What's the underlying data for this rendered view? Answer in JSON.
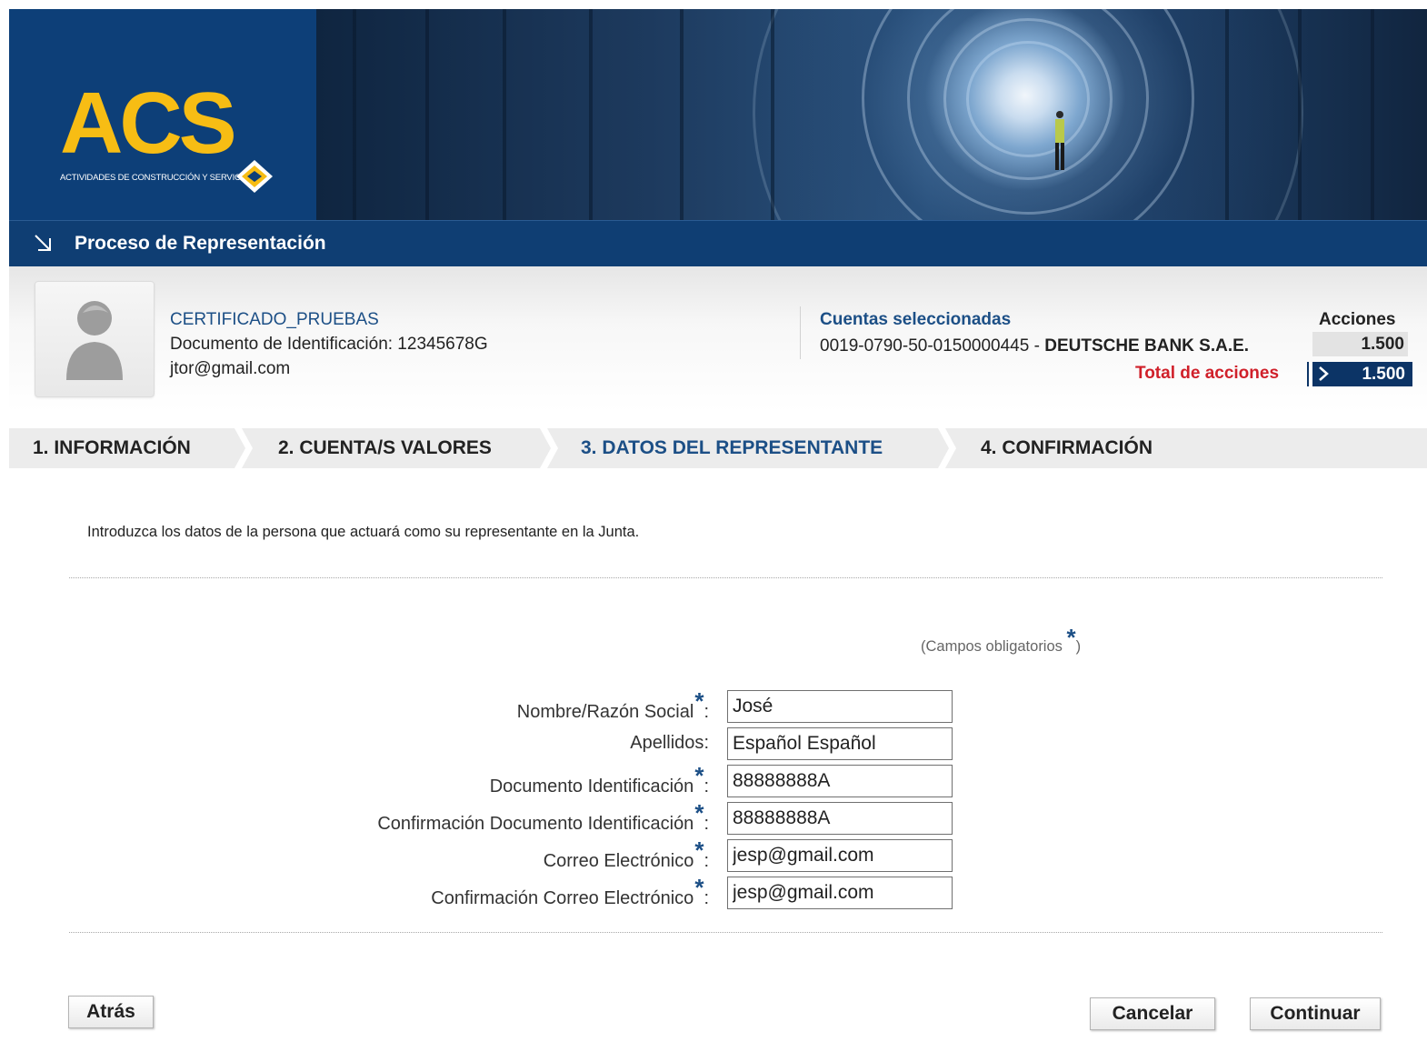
{
  "header": {
    "logo_text": "ACS",
    "logo_subtitle": "ACTIVIDADES DE CONSTRUCCIÓN Y SERVICIOS"
  },
  "title_bar": {
    "title": "Proceso de Representación"
  },
  "user": {
    "name": "CERTIFICADO_PRUEBAS",
    "document": "Documento de Identificación: 12345678G",
    "email": "jtor@gmail.com"
  },
  "accounts": {
    "title": "Cuentas seleccionadas",
    "account_number": "0019-0790-50-0150000445 - ",
    "bank": "DEUTSCHE BANK S.A.E.",
    "shares_header": "Acciones",
    "shares_value": "1.500",
    "total_label": "Total de acciones",
    "total_value": "1.500"
  },
  "steps": [
    {
      "label": "1. INFORMACIÓN"
    },
    {
      "label": "2. CUENTA/S VALORES"
    },
    {
      "label": "3. DATOS DEL REPRESENTANTE"
    },
    {
      "label": "4. CONFIRMACIÓN"
    }
  ],
  "active_step": "3. DATOS DEL REPRESENTANTE",
  "intro_text": "Introduzca los datos de la persona que actuará como su representante en la Junta.",
  "required_note": {
    "prefix": "(Campos obligatorios ",
    "star": "*",
    "suffix": ")"
  },
  "form": {
    "fields": [
      {
        "label": "Nombre/Razón Social",
        "required": true,
        "value": "José"
      },
      {
        "label": "Apellidos",
        "required": false,
        "value": "Español Español"
      },
      {
        "label": "Documento Identificación",
        "required": true,
        "value": "88888888A"
      },
      {
        "label": "Confirmación Documento Identificación",
        "required": true,
        "value": "88888888A"
      },
      {
        "label": "Correo Electrónico",
        "required": true,
        "value": "jesp@gmail.com"
      },
      {
        "label": "Confirmación Correo Electrónico",
        "required": true,
        "value": "jesp@gmail.com"
      }
    ]
  },
  "buttons": {
    "back": "Atrás",
    "cancel": "Cancelar",
    "continue": "Continuar"
  },
  "colors": {
    "brand_blue": "#0f3e73",
    "logo_yellow": "#f7bd14",
    "link_blue": "#1c4f86",
    "total_red": "#d0202a"
  },
  "icons": {
    "title_arrow": "arrow-down-right-icon",
    "avatar": "user-avatar-icon",
    "total_chevron": "chevron-right-icon",
    "required": "asterisk-icon"
  }
}
